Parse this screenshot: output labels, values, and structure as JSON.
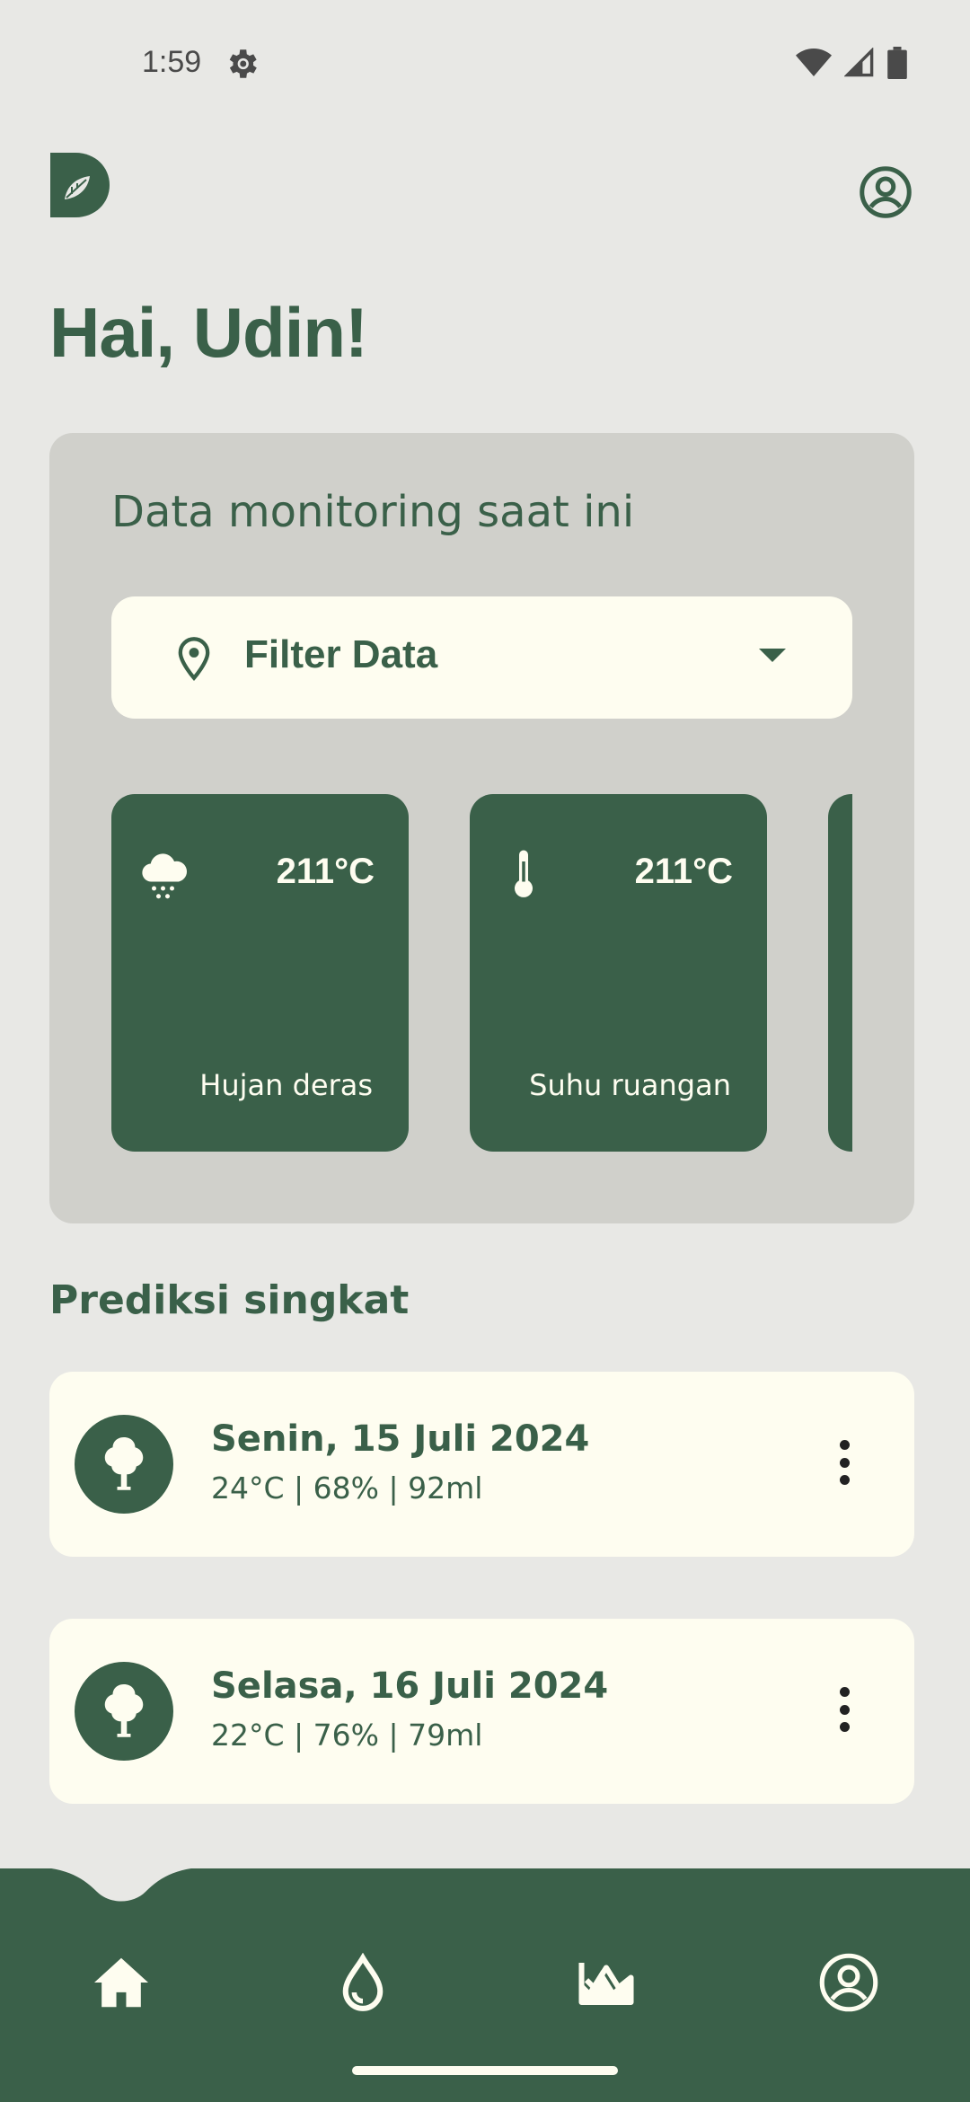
{
  "status_bar": {
    "time": "1:59"
  },
  "header": {
    "greeting": "Hai, Udin!"
  },
  "monitoring": {
    "title": "Data monitoring saat ini",
    "filter_label": "Filter Data",
    "cards": [
      {
        "icon": "snow-cloud-icon",
        "value": "211°C",
        "label": "Hujan deras"
      },
      {
        "icon": "thermometer-icon",
        "value": "211°C",
        "label": "Suhu ruangan"
      }
    ]
  },
  "predictions": {
    "title": "Prediksi singkat",
    "items": [
      {
        "date": "Senin, 15 Juli 2024",
        "stats": "24°C | 68% | 92ml",
        "icon": "tree-icon"
      },
      {
        "date": "Selasa, 16 Juli 2024",
        "stats": "22°C | 76% | 79ml",
        "icon": "tree-icon"
      }
    ]
  },
  "bottom_nav": [
    "home-icon",
    "water-drop-icon",
    "chart-icon",
    "profile-icon"
  ],
  "colors": {
    "primary": "#3a6049",
    "background": "#e8e8e5",
    "panel": "#d0d0cb",
    "card": "#fefdf0"
  }
}
